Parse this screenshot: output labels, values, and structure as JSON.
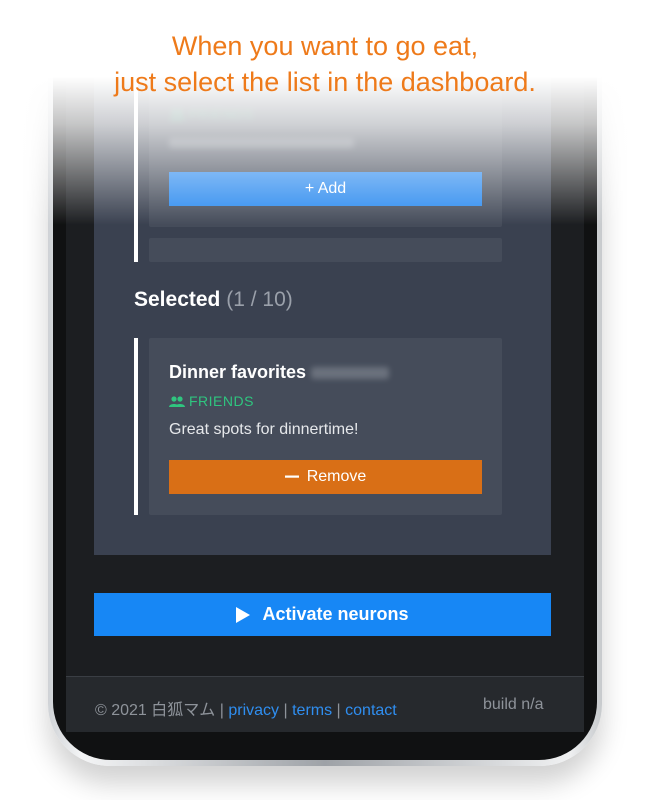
{
  "caption": {
    "line1": "When you want to go eat,",
    "line2": "just select the list in the dashboard."
  },
  "top_card": {
    "tag": "FRIENDS",
    "add_label": "+ Add"
  },
  "selected": {
    "title": "Selected",
    "count": "(1 / 10)",
    "card": {
      "title": "Dinner favorites",
      "tag": "FRIENDS",
      "description": "Great spots for dinnertime!",
      "remove_label": "Remove"
    }
  },
  "activate": {
    "label": "Activate neurons"
  },
  "footer": {
    "copyright": "© 2021 白狐マム",
    "links": [
      "privacy",
      "terms",
      "contact"
    ],
    "build": "build n/a"
  },
  "colors": {
    "caption": "#ee7a1a",
    "add_button": "#2b8aef",
    "remove_button": "#d96f16",
    "activate_button": "#1787f5",
    "friends_tag": "#2fc57f",
    "link": "#2f8ef0"
  }
}
